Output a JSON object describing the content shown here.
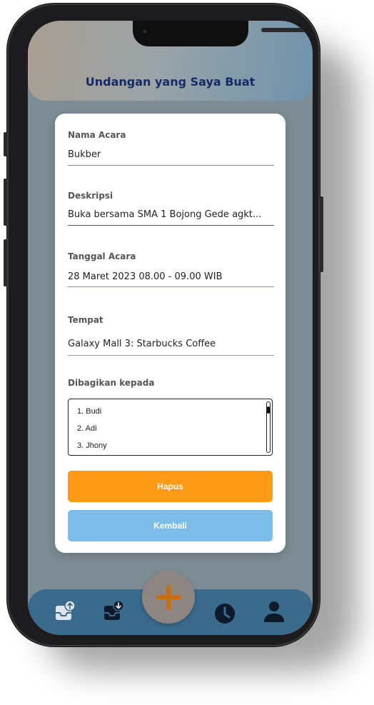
{
  "header": {
    "title": "Undangan yang Saya Buat"
  },
  "form": {
    "nama_acara": {
      "label": "Nama Acara",
      "value": "Bukber"
    },
    "deskripsi": {
      "label": "Deskripsi",
      "value": "Buka bersama SMA 1 Bojong Gede agkt..."
    },
    "tanggal": {
      "label": "Tanggal Acara",
      "value": "28 Maret 2023 08.00 - 09.00 WIB"
    },
    "tempat": {
      "label": "Tempat",
      "value": "Galaxy Mall 3: Starbucks Coffee"
    },
    "dibagikan": {
      "label": "Dibagikan kepada",
      "items": [
        "1. Budi",
        "2. Adi",
        "3. Jhony"
      ]
    }
  },
  "buttons": {
    "hapus": "Hapus",
    "kembali": "Kembali"
  },
  "fab": {
    "symbol": "+"
  },
  "nav": {
    "icons": [
      "upload-invitation-icon",
      "download-invitation-icon",
      "history-clock-icon",
      "profile-icon"
    ]
  },
  "colors": {
    "header_title": "#162a66",
    "hapus": "#ff9a17",
    "kembali": "#7bbde8",
    "nav_bg": "#3a6a8c",
    "fab_plus": "#c96f10"
  }
}
